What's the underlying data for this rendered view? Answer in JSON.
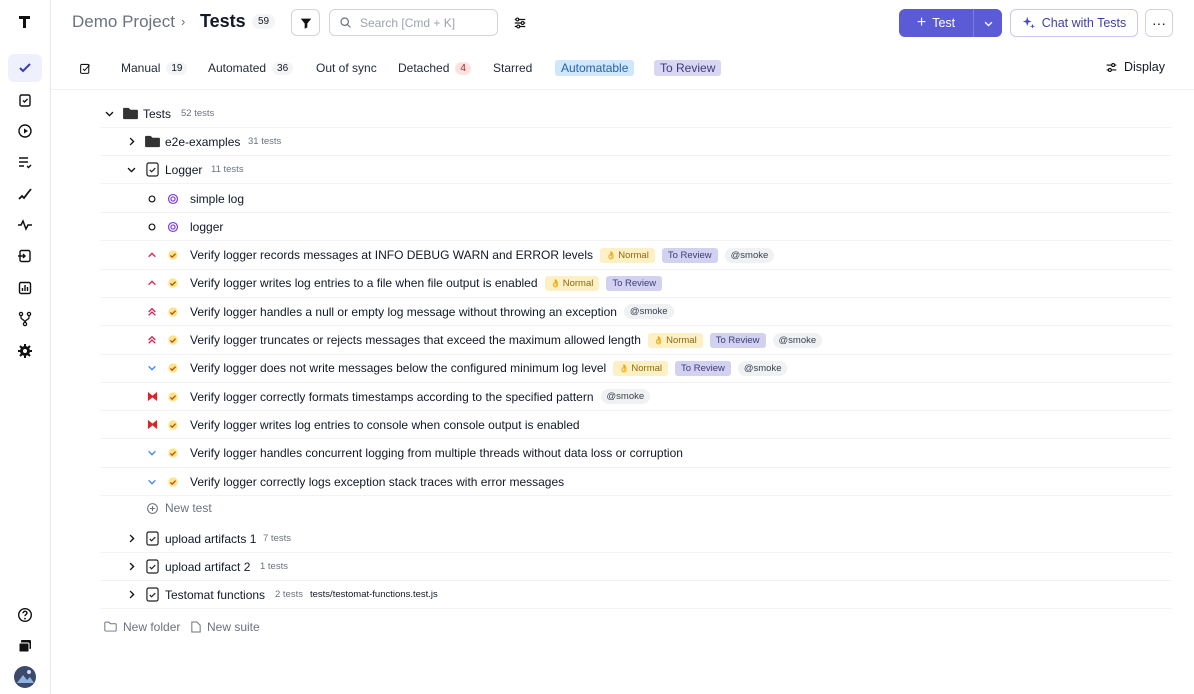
{
  "header": {
    "project": "Demo Project",
    "separator": "›",
    "title": "Tests",
    "count": "59",
    "search_placeholder": "Search [Cmd + K]",
    "test_button": "Test",
    "chat_button": "Chat with Tests",
    "more": "···"
  },
  "tabs": {
    "manual": "Manual",
    "manual_count": "19",
    "automated": "Automated",
    "automated_count": "36",
    "out_of_sync": "Out of sync",
    "detached": "Detached",
    "detached_count": "4",
    "starred": "Starred",
    "automatable": "Automatable",
    "to_review": "To Review",
    "display": "Display"
  },
  "tree": {
    "root": {
      "name": "Tests",
      "count": "52 tests"
    },
    "e2e": {
      "name": "e2e-examples",
      "count": "31 tests"
    },
    "logger": {
      "name": "Logger",
      "count": "11 tests"
    },
    "tests": [
      {
        "title": "simple log",
        "tags": []
      },
      {
        "title": "logger",
        "tags": []
      },
      {
        "title": "Verify logger records messages at INFO DEBUG WARN and ERROR levels",
        "normal": "Normal",
        "review": "To Review",
        "smoke": "@smoke"
      },
      {
        "title": "Verify logger writes log entries to a file when file output is enabled",
        "normal": "Normal",
        "review": "To Review"
      },
      {
        "title": "Verify logger handles a null or empty log message without throwing an exception",
        "smoke": "@smoke"
      },
      {
        "title": "Verify logger truncates or rejects messages that exceed the maximum allowed length",
        "normal": "Normal",
        "review": "To Review",
        "smoke": "@smoke"
      },
      {
        "title": "Verify logger does not write messages below the configured minimum log level",
        "normal": "Normal",
        "review": "To Review",
        "smoke": "@smoke"
      },
      {
        "title": "Verify logger correctly formats timestamps according to the specified pattern",
        "smoke": "@smoke"
      },
      {
        "title": "Verify logger writes log entries to console when console output is enabled"
      },
      {
        "title": "Verify logger handles concurrent logging from multiple threads without data loss or corruption"
      },
      {
        "title": "Verify logger correctly logs exception stack traces with error messages"
      }
    ],
    "new_test": "New test",
    "upload1": {
      "name": "upload artifacts 1",
      "count": "7 tests"
    },
    "upload2": {
      "name": "upload artifact 2",
      "count": "1 tests"
    },
    "testomat": {
      "name": "Testomat functions",
      "count": "2 tests",
      "path": "tests/testomat-functions.test.js"
    },
    "new_folder": "New folder",
    "new_suite": "New suite"
  },
  "colors": {
    "accent": "#5b5bd6",
    "normal_bg": "#fdf0c4",
    "review_bg": "#d3d1f0"
  }
}
